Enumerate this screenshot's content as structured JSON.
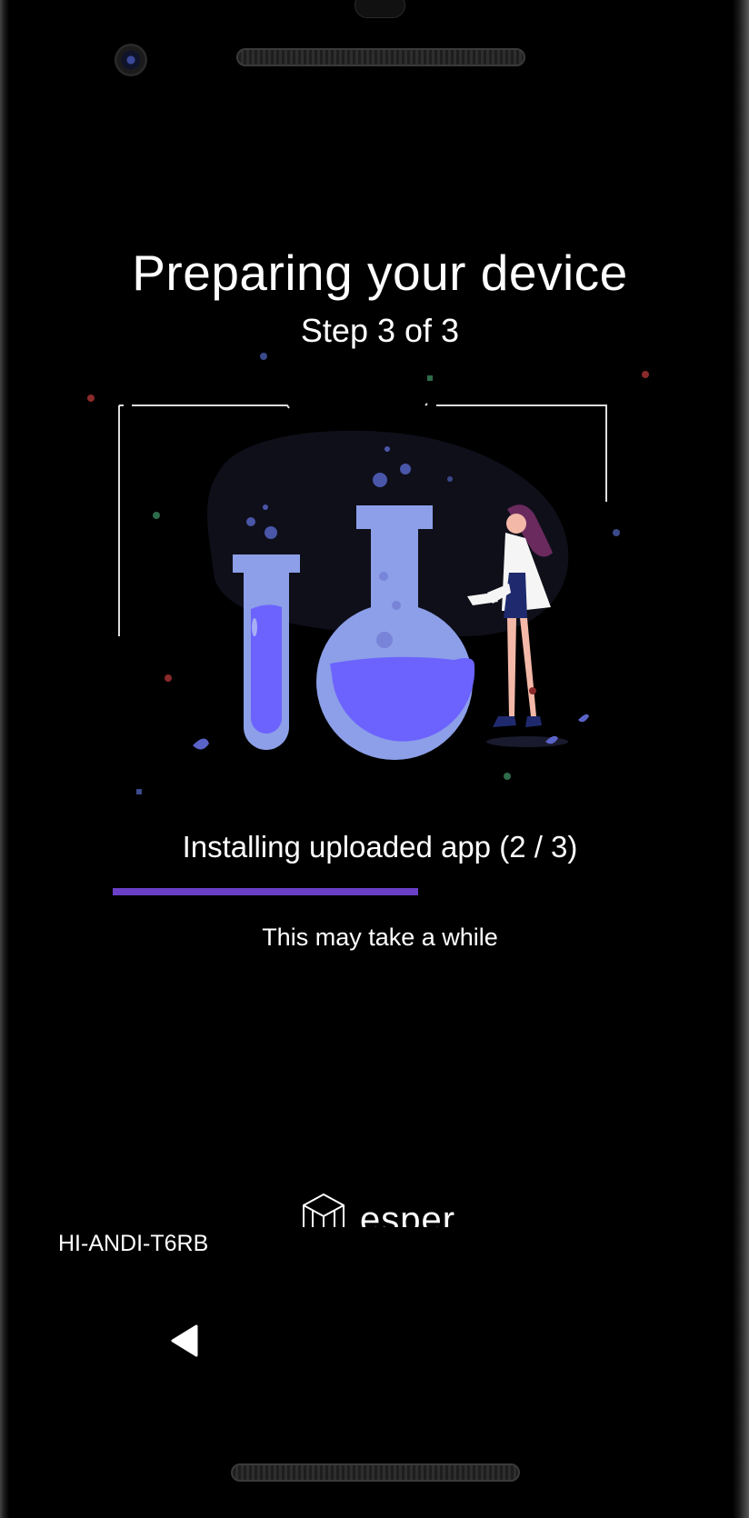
{
  "screen": {
    "title": "Preparing your device",
    "step": "Step 3 of 3",
    "status": "Installing uploaded app (2 / 3)",
    "progress": 0.57,
    "hint": "This may take a while",
    "device_id": "HI-ANDI-T6RB"
  },
  "brand": {
    "name": "esper",
    "logo_icon": "esper-cube-icon"
  },
  "navigation": {
    "back_icon": "back-triangle-icon"
  },
  "colors": {
    "background": "#000000",
    "progress": "#6a3fc6",
    "illustration_primary": "#8c9fe8",
    "illustration_liquid": "#6c63ff",
    "blob": "#0f0f1a"
  }
}
